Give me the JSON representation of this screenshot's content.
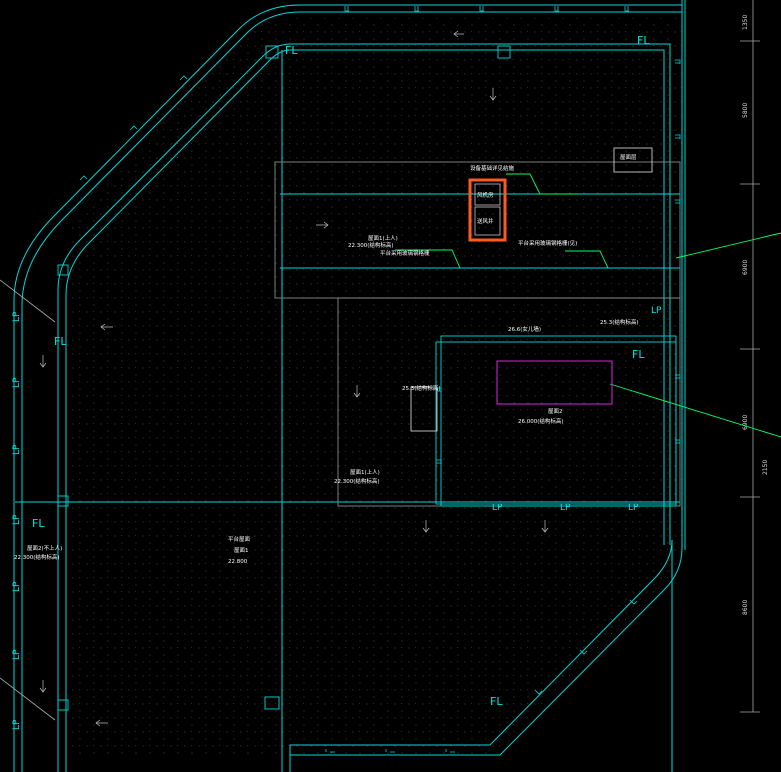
{
  "drawing": {
    "background": "#000000",
    "colors": {
      "wall": "#00d8d8",
      "leader": "#00ff66",
      "highlight": "#ff5a1e",
      "magenta": "#e020e0",
      "dim_line": "#a8a8a8",
      "white": "#ffffff"
    },
    "labels": {
      "fl": "FL",
      "lp": "LP",
      "roof1": "屋面1(上人)",
      "roof1_elev": "22.300(结构标高)",
      "roof2_left": "屋面2(不上人)",
      "roof2_left_elev": "22.300(结构标高)",
      "roof_mid": "屋面1(上人)",
      "roof_mid_elev": "22.300(结构标高)",
      "roof_top": "屋面2",
      "roof_top_elev": "26.000(结构标高)",
      "center_title": "平台屋面",
      "center_sub": "屋面1",
      "center_elev": "22.800",
      "elev_25_3_a": "25.3(结构标高)",
      "elev_25_3_b": "25.3(结构标高)",
      "elev_26_6": "26.6(女儿墙)",
      "room_label": "屋面层",
      "note_top": "设备基础详见结施",
      "note_mid_left": "平台采用玻璃钢格栅",
      "note_mid_right": "平台采用玻璃钢格栅(见)",
      "box_a": "风机房",
      "box_b": "送风井"
    },
    "dimensions": [
      "1350",
      "5800",
      "6900",
      "6900",
      "2150",
      "8600"
    ]
  }
}
